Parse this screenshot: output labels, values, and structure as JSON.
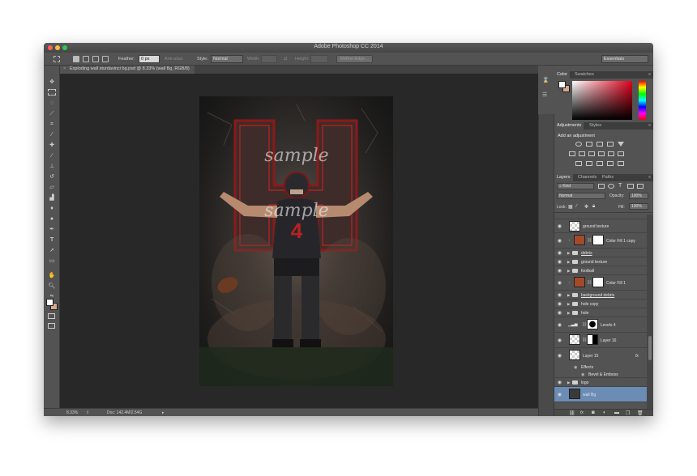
{
  "window": {
    "title": "Adobe Photoshop CC 2014"
  },
  "options_bar": {
    "feather_label": "Feather:",
    "feather_value": "0 px",
    "antialias_label": "Anti-alias",
    "style_label": "Style:",
    "style_value": "Normal",
    "width_label": "Width:",
    "height_label": "Height:",
    "refine_edge": "Refine Edge...",
    "workspace": "Essentials"
  },
  "document": {
    "tab": "Exploding wall sturdavinci bg.psd @ 8.33% (wall Bg, RGB/8)"
  },
  "artwork": {
    "watermark": "sample",
    "jersey_number": "4"
  },
  "status_bar": {
    "zoom": "8.33%",
    "doc_size": "Doc: 142.4M/2.54G"
  },
  "color_panel": {
    "tabs": [
      "Color",
      "Swatches"
    ],
    "foreground": "#ffffff",
    "background": "#d8a88e"
  },
  "adjustments_panel": {
    "tabs": [
      "Adjustments",
      "Styles"
    ],
    "title": "Add an adjustment"
  },
  "layers_panel": {
    "tabs": [
      "Layers",
      "Channels",
      "Paths"
    ],
    "kind": "Kind",
    "blend_mode": "Normal",
    "opacity_label": "Opacity:",
    "opacity_value": "100%",
    "lock_label": "Lock:",
    "fill_label": "Fill:",
    "fill_value": "100%",
    "layers": [
      {
        "name": "ground texture",
        "kind": "pixel"
      },
      {
        "name": "Color Fill 1 copy",
        "kind": "fill"
      },
      {
        "name": "debris",
        "kind": "group"
      },
      {
        "name": "ground texture",
        "kind": "group"
      },
      {
        "name": "football",
        "kind": "group"
      },
      {
        "name": "Color Fill 1",
        "kind": "fill"
      },
      {
        "name": "background debris",
        "kind": "group"
      },
      {
        "name": "hole copy",
        "kind": "group"
      },
      {
        "name": "hole",
        "kind": "group"
      },
      {
        "name": "Levels 4",
        "kind": "adjustment"
      },
      {
        "name": "Layer 16",
        "kind": "masked"
      },
      {
        "name": "Layer 15",
        "kind": "fx",
        "fx_symbol": "fx"
      },
      {
        "name": "Effects",
        "kind": "effects-header"
      },
      {
        "name": "Bevel & Emboss",
        "kind": "effect"
      },
      {
        "name": "logo",
        "kind": "group"
      },
      {
        "name": "wall Bg",
        "kind": "selected"
      }
    ]
  }
}
